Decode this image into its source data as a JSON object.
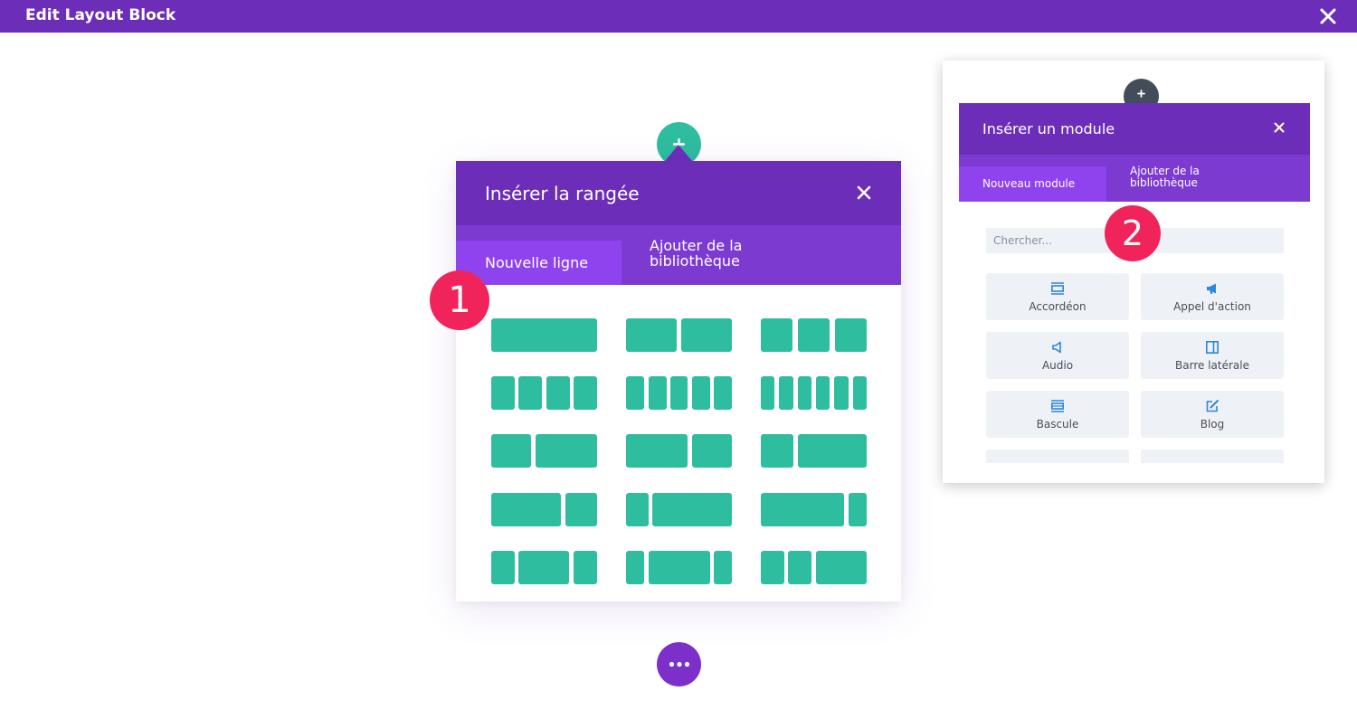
{
  "topbar": {
    "title": "Edit Layout Block"
  },
  "row_panel": {
    "title": "Insérer la rangée",
    "tabs": {
      "new_label": "Nouvelle ligne",
      "library_label": "Ajouter de la bibliothèque"
    },
    "layouts": [
      {
        "name": "layout-1-col"
      },
      {
        "name": "layout-2-col"
      },
      {
        "name": "layout-3-col"
      },
      {
        "name": "layout-4-col"
      },
      {
        "name": "layout-5-col"
      },
      {
        "name": "layout-6-col"
      },
      {
        "name": "layout-1-3-2-3"
      },
      {
        "name": "layout-2-3-1-3"
      },
      {
        "name": "layout-1-4-3-4"
      },
      {
        "name": "layout-3-4-1-4"
      },
      {
        "name": "layout-1-4-3-4-b"
      },
      {
        "name": "layout-4-5-1-5"
      },
      {
        "name": "layout-1-4-1-2-1-4"
      },
      {
        "name": "layout-1-5-3-5-1-5"
      },
      {
        "name": "layout-1-4-1-4-1-2"
      }
    ]
  },
  "module_panel": {
    "title": "Insérer un module",
    "tabs": {
      "new_label": "Nouveau module",
      "library_label": "Ajouter de la bibliothèque"
    },
    "search_placeholder": "Chercher...",
    "modules": [
      {
        "label": "Accordéon",
        "icon": "accordion-icon"
      },
      {
        "label": "Appel d'action",
        "icon": "megaphone-icon"
      },
      {
        "label": "Audio",
        "icon": "speaker-icon"
      },
      {
        "label": "Barre latérale",
        "icon": "sidebar-icon"
      },
      {
        "label": "Bascule",
        "icon": "toggle-icon"
      },
      {
        "label": "Blog",
        "icon": "blog-edit-icon"
      }
    ]
  },
  "badges": {
    "step1": "1",
    "step2": "2"
  },
  "colors": {
    "primary_purple": "#6c2eb9",
    "tab_purple": "#7d3ad1",
    "active_tab": "#8f43ee",
    "teal": "#2ebd9f",
    "badge_red": "#f0245a",
    "module_bg": "#eef1f6",
    "icon_blue": "#2b87da"
  }
}
